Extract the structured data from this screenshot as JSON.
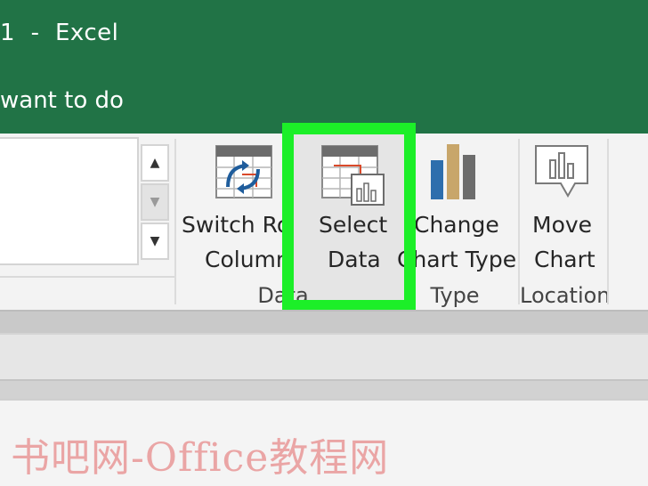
{
  "titlebar": {
    "title": "1  -  Excel",
    "tell_me": "want to do"
  },
  "gallery": {
    "scroll_up": "▲",
    "scroll_down": "▼",
    "more": "▼"
  },
  "ribbon": {
    "switch_row_col": {
      "line1": "Switch Row/",
      "line2": "Column"
    },
    "select_data": {
      "line1": "Select",
      "line2": "Data"
    },
    "change_chart_type": {
      "line1": "Change",
      "line2": "Chart Type"
    },
    "move_chart": {
      "line1": "Move",
      "line2": "Chart"
    },
    "groups": {
      "data": "Data",
      "type": "Type",
      "location": "Location"
    }
  },
  "watermark": "书吧网-Office教程网",
  "colors": {
    "title_bg": "#217346",
    "highlight": "#1cef28",
    "chart_blue": "#2e6ead",
    "chart_tan": "#c8a66a",
    "chart_gray": "#6c6c6c"
  }
}
